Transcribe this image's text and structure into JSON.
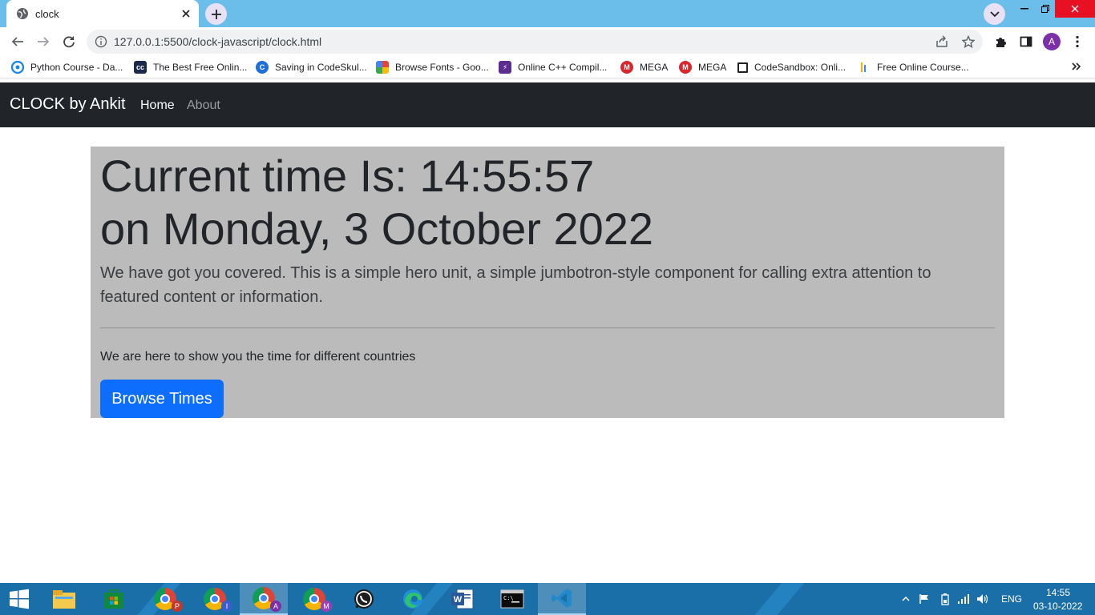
{
  "browser": {
    "tab_title": "clock",
    "url": "127.0.0.1:5500/clock-javascript/clock.html",
    "profile_initial": "A",
    "bookmarks": [
      {
        "label": "Python Course - Da..."
      },
      {
        "label": "The Best Free Onlin..."
      },
      {
        "label": "Saving in CodeSkul..."
      },
      {
        "label": "Browse Fonts - Goo..."
      },
      {
        "label": "Online C++ Compil..."
      },
      {
        "label": "MEGA"
      },
      {
        "label": "MEGA"
      },
      {
        "label": "CodeSandbox: Onli..."
      },
      {
        "label": "Free Online Course..."
      }
    ]
  },
  "navbar": {
    "brand": "CLOCK by Ankit",
    "links": [
      {
        "label": "Home"
      },
      {
        "label": "About"
      }
    ]
  },
  "jumbotron": {
    "time_line": "Current time Is: 14:55:57",
    "date_line": "on Monday, 3 October 2022",
    "lead": "We have got you covered. This is a simple hero unit, a simple jumbotron-style component for calling extra attention to featured content or information.",
    "sub": "We are here to show you the time for different countries",
    "button": "Browse Times"
  },
  "taskbar": {
    "badges": [
      "P",
      "I",
      "A",
      "M"
    ],
    "language": "ENG",
    "clock_time": "14:55",
    "clock_date": "03-10-2022"
  },
  "colors": {
    "tabstrip": "#6bbdea",
    "navbar": "#212529",
    "jumbotron": "#bbbbbb",
    "primary_button": "#0d6efd",
    "taskbar": "#1b6fa8"
  }
}
